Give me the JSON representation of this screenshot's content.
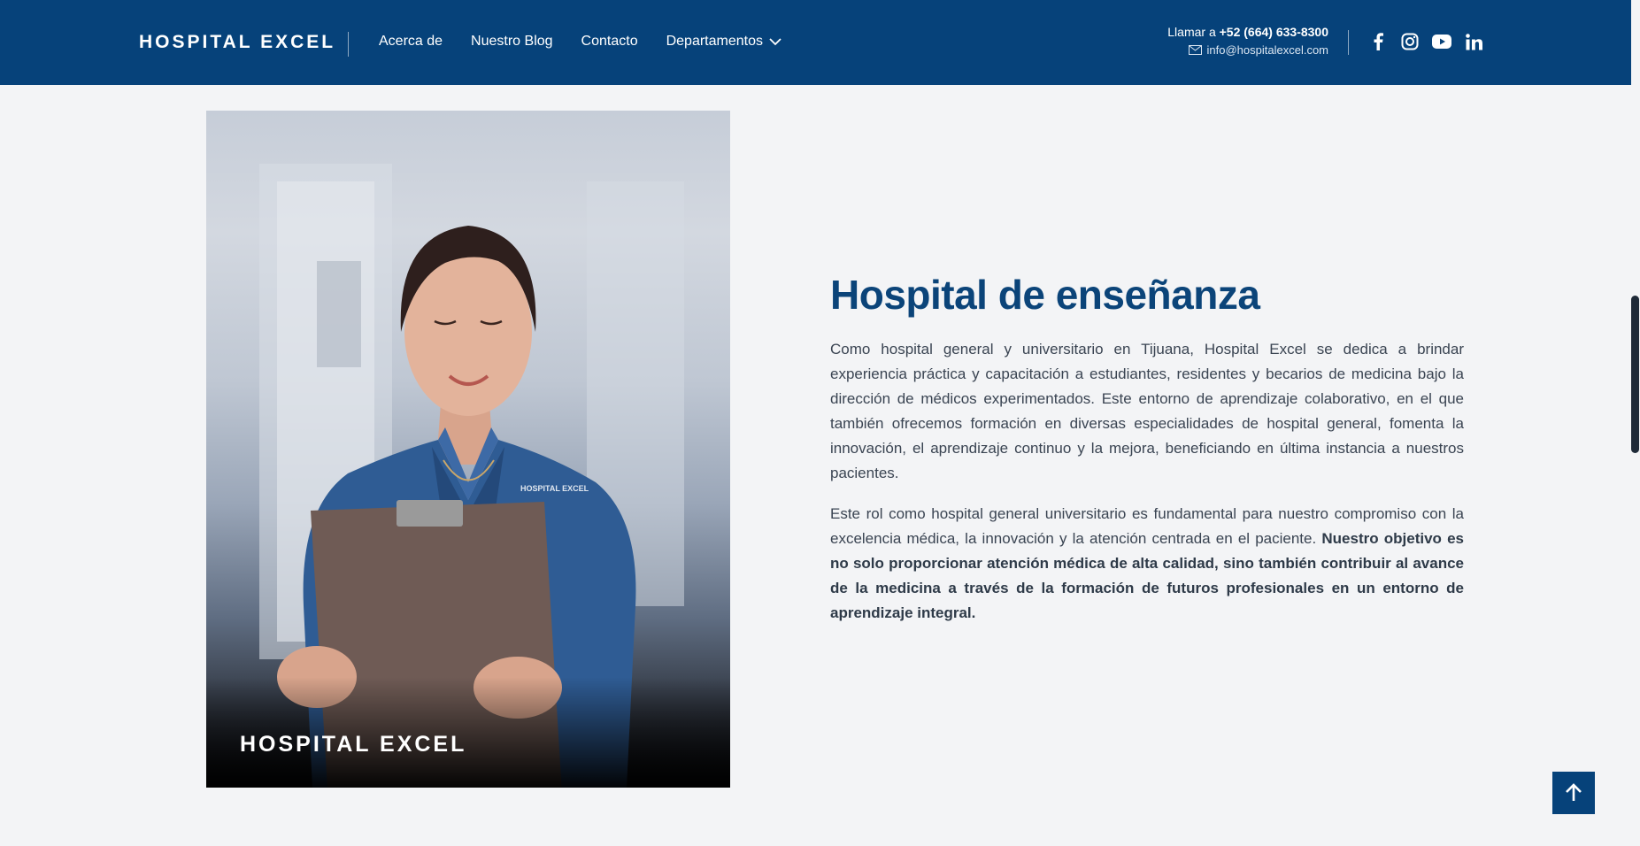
{
  "header": {
    "brand": "HOSPITAL EXCEL",
    "nav": [
      {
        "label": "Acerca de"
      },
      {
        "label": "Nuestro Blog"
      },
      {
        "label": "Contacto"
      },
      {
        "label": "Departamentos",
        "has_dropdown": true
      }
    ],
    "call_prefix": "Llamar a",
    "phone": "+52 (664) 633-8300",
    "email": "info@hospitalexcel.com",
    "socials": [
      "facebook-icon",
      "instagram-icon",
      "youtube-icon",
      "linkedin-icon"
    ]
  },
  "image": {
    "caption": "HOSPITAL EXCEL",
    "shirt_logo": "HOSPITAL EXCEL"
  },
  "section": {
    "title": "Hospital de enseñanza",
    "paragraph1": "Como hospital general y universitario en Tijuana, Hospital Excel se dedica a brindar experiencia práctica y capacitación a estudiantes, residentes y becarios de medicina bajo la dirección de médicos experimentados. Este entorno de aprendizaje colaborativo, en el que también ofrecemos formación en diversas especialidades de hospital general, fomenta la innovación, el aprendizaje continuo y la mejora, beneficiando en última instancia a nuestros pacientes.",
    "paragraph2_normal": "Este rol como hospital general universitario es fundamental para nuestro compromiso con la excelencia médica, la innovación y la atención centrada en el paciente. ",
    "paragraph2_bold": "Nuestro objetivo es no solo proporcionar atención médica de alta calidad, sino también contribuir al avance de la medicina a través de la formación de futuros profesionales en un entorno de aprendizaje integral."
  },
  "scroll_top_icon": "arrow-up-icon",
  "colors": {
    "primary": "#06427a",
    "title": "#0b4479",
    "background": "#f3f4f6",
    "text": "#374151"
  }
}
